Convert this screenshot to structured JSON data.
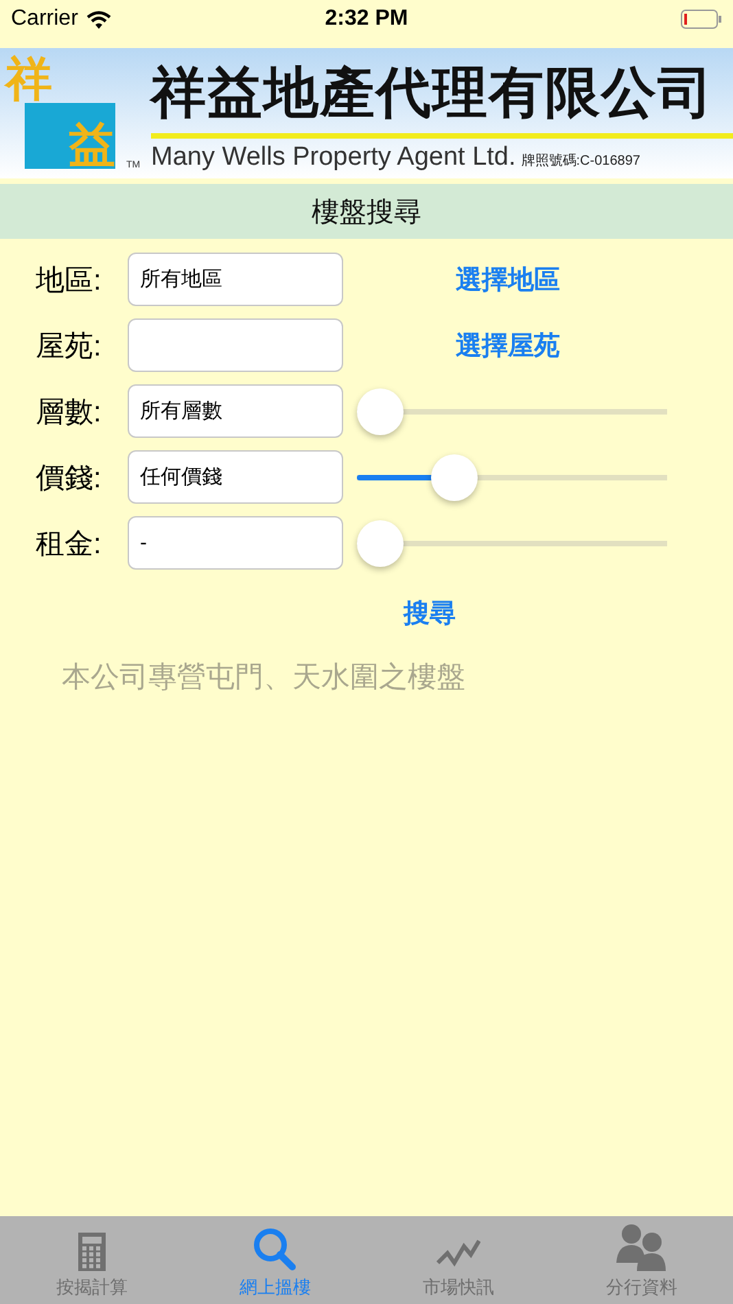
{
  "status_bar": {
    "carrier": "Carrier",
    "time": "2:32 PM"
  },
  "banner": {
    "logo_top": "祥",
    "logo_bottom": "益",
    "trademark": "TM",
    "title": "祥益地產代理有限公司",
    "subtitle": "Many Wells Property Agent Ltd.",
    "license": "牌照號碼:C-016897"
  },
  "header": {
    "title": "樓盤搜尋"
  },
  "form": {
    "rows": [
      {
        "kind": "link",
        "label": "地區:",
        "value": "所有地區",
        "link": "選擇地區"
      },
      {
        "kind": "link",
        "label": "屋苑:",
        "link": "選擇屋苑"
      },
      {
        "kind": "slider",
        "label": "層數:",
        "value": "所有層數",
        "level": 0
      },
      {
        "kind": "slider",
        "label": "價錢:",
        "value": "任何價錢",
        "level": 0.28
      },
      {
        "kind": "slider",
        "label": "租金:",
        "value": "-",
        "level": 0
      }
    ],
    "search": "搜尋",
    "note": "本公司專營屯門、天水圍之樓盤"
  },
  "tab_bar": {
    "tabs": [
      {
        "kind": "calculator",
        "label": "按揭計算",
        "selected": false
      },
      {
        "kind": "search",
        "label": "網上搵樓",
        "selected": true
      },
      {
        "kind": "chart",
        "label": "市場快訊",
        "selected": false
      },
      {
        "kind": "people",
        "label": "分行資料",
        "selected": false
      }
    ]
  }
}
